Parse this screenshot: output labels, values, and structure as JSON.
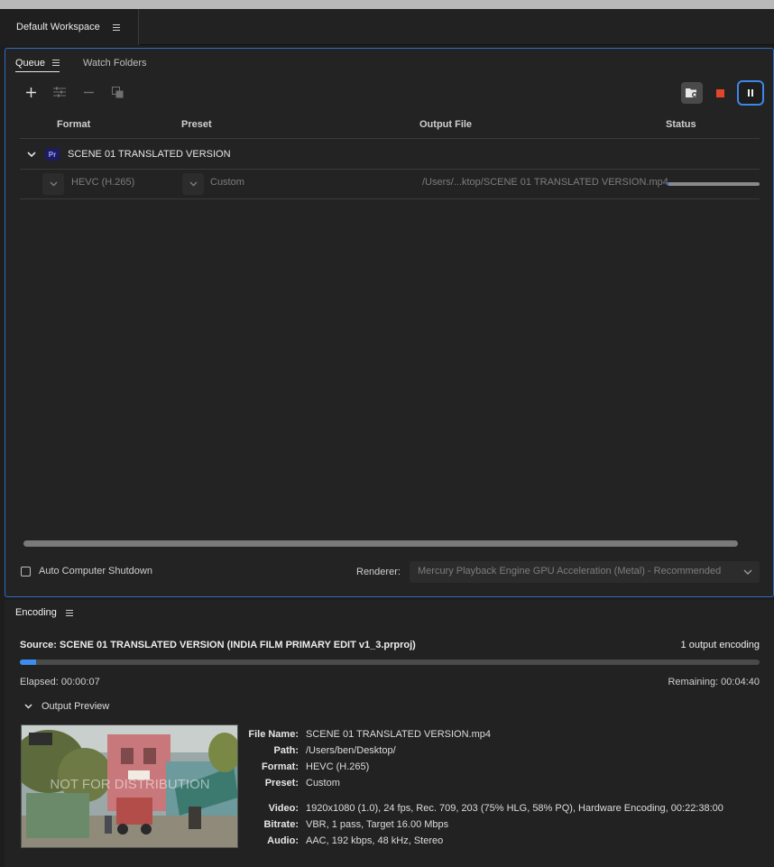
{
  "workspace": {
    "title": "Default Workspace"
  },
  "queue": {
    "tabs": [
      {
        "label": "Queue"
      },
      {
        "label": "Watch Folders"
      }
    ],
    "columns": {
      "format": "Format",
      "preset": "Preset",
      "output": "Output File",
      "status": "Status"
    },
    "group": {
      "badge": "Pr",
      "title": "SCENE 01 TRANSLATED VERSION"
    },
    "item": {
      "format": "HEVC (H.265)",
      "preset": "Custom",
      "output": "/Users/...ktop/SCENE 01 TRANSLATED VERSION.mp4",
      "progress_percent": 2
    },
    "auto_shutdown_label": "Auto Computer Shutdown",
    "auto_shutdown_checked": false,
    "renderer_label": "Renderer:",
    "renderer_value": "Mercury Playback Engine GPU Acceleration (Metal) - Recommended"
  },
  "encoding": {
    "tab_label": "Encoding",
    "source": "Source: SCENE 01 TRANSLATED VERSION (INDIA FILM PRIMARY EDIT v1_3.prproj)",
    "outputs": "1 output encoding",
    "progress_percent": 2.2,
    "elapsed": "Elapsed: 00:00:07",
    "remaining": "Remaining: 00:04:40",
    "output_preview_label": "Output Preview",
    "watermark": "NOT FOR DISTRIBUTION",
    "info": {
      "file_name_label": "File Name:",
      "file_name": "SCENE 01 TRANSLATED VERSION.mp4",
      "path_label": "Path:",
      "path": "/Users/ben/Desktop/",
      "format_label": "Format:",
      "format": "HEVC (H.265)",
      "preset_label": "Preset:",
      "preset": "Custom",
      "video_label": "Video:",
      "video": "1920x1080 (1.0), 24 fps, Rec. 709, 203 (75% HLG, 58% PQ), Hardware Encoding, 00:22:38:00",
      "bitrate_label": "Bitrate:",
      "bitrate": "VBR, 1 pass, Target 16.00 Mbps",
      "audio_label": "Audio:",
      "audio": "AAC, 192 kbps, 48 kHz, Stereo"
    }
  },
  "colors": {
    "accent": "#3b8df0",
    "stop": "#e3452b",
    "focus": "#3e86e8"
  }
}
